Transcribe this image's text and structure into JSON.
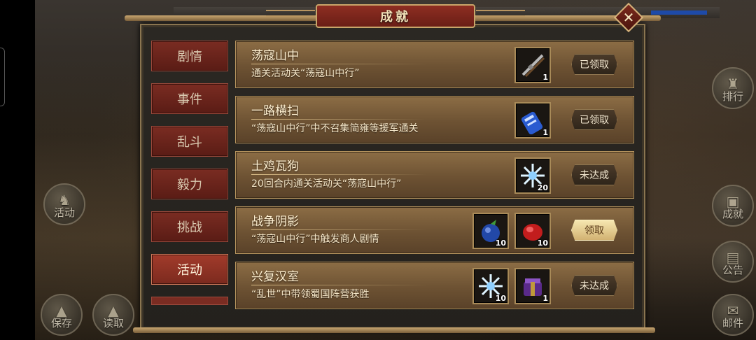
{
  "dialog": {
    "title": "成就",
    "close_symbol": "✕"
  },
  "categories": [
    {
      "label": "剧情",
      "active": false
    },
    {
      "label": "事件",
      "active": false
    },
    {
      "label": "乱斗",
      "active": false
    },
    {
      "label": "毅力",
      "active": false
    },
    {
      "label": "挑战",
      "active": false
    },
    {
      "label": "活动",
      "active": true
    }
  ],
  "achievements": [
    {
      "title": "荡寇山中",
      "desc": "通关活动关“荡寇山中行”",
      "rewards": [
        {
          "icon": "rifle-icon",
          "count": "1"
        }
      ],
      "status": "已领取"
    },
    {
      "title": "一路横扫",
      "desc": "“荡寇山中行”中不召集简雍等援军通关",
      "rewards": [
        {
          "icon": "scroll-icon",
          "count": "1"
        }
      ],
      "status": "已领取"
    },
    {
      "title": "土鸡瓦狗",
      "desc": "20回合内通关活动关“荡寇山中行”",
      "rewards": [
        {
          "icon": "ice-crystal-icon",
          "count": "20"
        }
      ],
      "status": "未达成"
    },
    {
      "title": "战争阴影",
      "desc": "“荡寇山中行”中触发商人剧情",
      "rewards": [
        {
          "icon": "fruit-icon",
          "count": "10"
        },
        {
          "icon": "red-gem-icon",
          "count": "10"
        }
      ],
      "status": "领取"
    },
    {
      "title": "兴复汉室",
      "desc": "“乱世”中带领蜀国阵营获胜",
      "rewards": [
        {
          "icon": "ice-crystal-icon",
          "count": "10"
        },
        {
          "icon": "purple-box-icon",
          "count": "1"
        }
      ],
      "status": "未达成"
    }
  ],
  "side_buttons": {
    "ranking": "排行",
    "activity": "活动",
    "achievement": "成就",
    "notice": "公告",
    "save": "保存",
    "load": "读取",
    "mail": "邮件"
  }
}
